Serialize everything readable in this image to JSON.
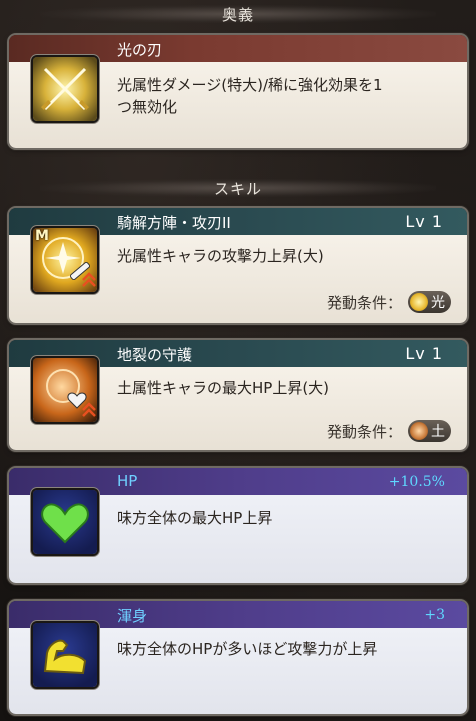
{
  "sections": {
    "ougi_header": "奥義",
    "skill_header": "スキル"
  },
  "ougi": {
    "name": "光の刃",
    "description_line1": "光属性ダメージ(特大)/稀に強化効果を1",
    "description_line2": "つ無効化",
    "icon": "crossed-swords-icon"
  },
  "skills": [
    {
      "name": "騎解方陣・攻刃II",
      "level": "Lv 1",
      "description": "光属性キャラの攻撃力上昇(大)",
      "condition_label": "発動条件：",
      "element_label": "光",
      "element_color": "#f2c94c",
      "icon": "sword-attack-up-icon",
      "badge": "M"
    },
    {
      "name": "地裂の守護",
      "level": "Lv 1",
      "description": "土属性キャラの最大HP上昇(大)",
      "condition_label": "発動条件：",
      "element_label": "土",
      "element_color": "#c87a3a",
      "icon": "heart-hp-up-icon"
    }
  ],
  "support": [
    {
      "name": "HP",
      "bonus": "+10.5%",
      "description": "味方全体の最大HP上昇",
      "icon": "green-heart-icon"
    },
    {
      "name": "渾身",
      "bonus": "+3",
      "description": "味方全体のHPが多いほど攻撃力が上昇",
      "icon": "flexed-arm-icon"
    }
  ],
  "colors": {
    "ougi_header": "#7a3a30",
    "skill_header": "#2a4a50",
    "support_header": "#4f3d8a",
    "bonus_text": "#5fd8ff"
  }
}
